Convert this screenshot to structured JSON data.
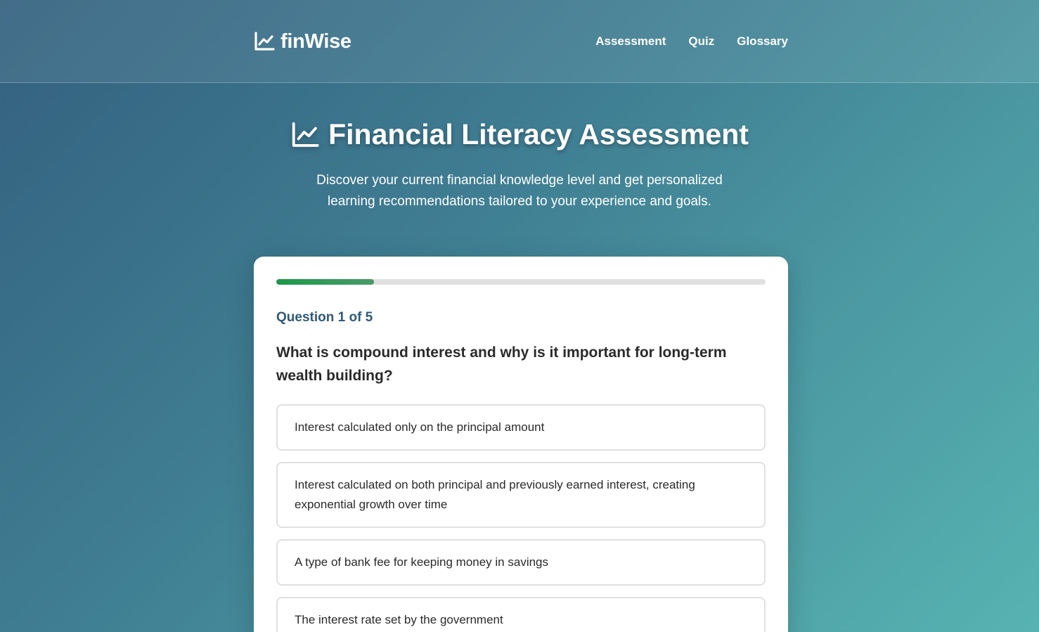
{
  "header": {
    "brand": "finWise",
    "brand_icon": "chart-line-icon",
    "nav": [
      "Assessment",
      "Quiz",
      "Glossary"
    ]
  },
  "hero": {
    "title": "Financial Literacy Assessment",
    "title_icon": "chart-line-icon",
    "subtitle": "Discover your current financial knowledge level and get personalized learning recommendations tailored to your experience and goals."
  },
  "quiz": {
    "progress": 0.2,
    "counter": "Question 1 of 5",
    "question": "What is compound interest and why is it important for long-term wealth building?",
    "options": [
      "Interest calculated only on the principal amount",
      "Interest calculated on both principal and previously earned interest, creating exponential growth over time",
      "A type of bank fee for keeping money in savings",
      "The interest rate set by the government"
    ]
  },
  "colors": {
    "accent": "#2f5a7a",
    "progress": "#1a9a4a"
  }
}
